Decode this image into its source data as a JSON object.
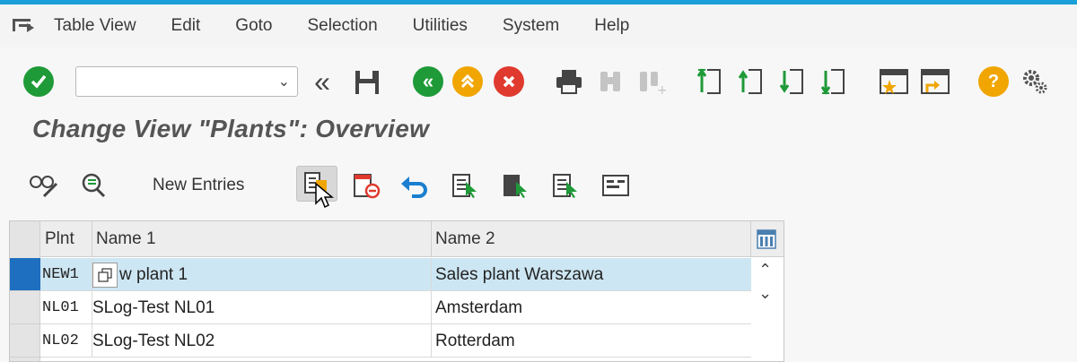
{
  "menu": [
    "Table View",
    "Edit",
    "Goto",
    "Selection",
    "Utilities",
    "System",
    "Help"
  ],
  "title": "Change View \"Plants\": Overview",
  "app_toolbar": {
    "new_entries": "New Entries"
  },
  "table": {
    "columns": [
      "Plnt",
      "Name 1",
      "Name 2"
    ],
    "rows": [
      {
        "plnt": "NEW1",
        "name1": "w plant 1",
        "name2": "Sales plant Warszawa",
        "selected": true
      },
      {
        "plnt": "NL01",
        "name1": "SLog-Test NL01",
        "name2": "Amsterdam",
        "selected": false
      },
      {
        "plnt": "NL02",
        "name1": "SLog-Test NL02",
        "name2": "Rotterdam",
        "selected": false
      }
    ]
  },
  "colors": {
    "accent": "#1a9fd8",
    "green": "#1f9a38",
    "orange": "#f0a500",
    "red": "#e03a2f",
    "selection": "#cde6f3"
  }
}
